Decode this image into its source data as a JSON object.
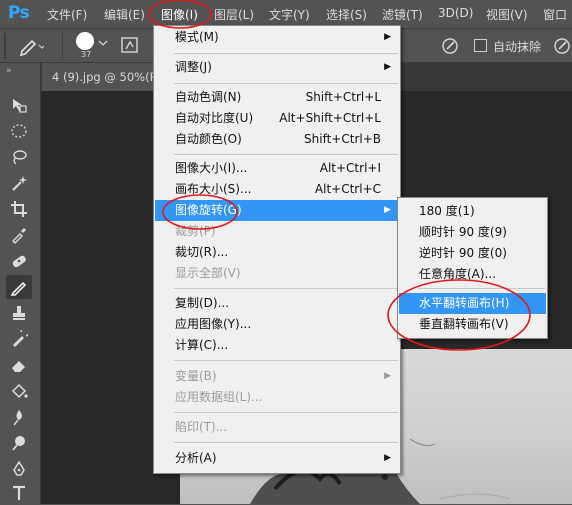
{
  "app": {
    "logo": "Ps"
  },
  "menubar": {
    "items": [
      {
        "label": "文件(F)"
      },
      {
        "label": "编辑(E)"
      },
      {
        "label": "图像(I)"
      },
      {
        "label": "图层(L)"
      },
      {
        "label": "文字(Y)"
      },
      {
        "label": "选择(S)"
      },
      {
        "label": "滤镜(T)"
      },
      {
        "label": "3D(D)"
      },
      {
        "label": "视图(V)"
      },
      {
        "label": "窗口"
      }
    ]
  },
  "options_bar": {
    "brush_size": "37",
    "auto_erase_label": "自动抹除"
  },
  "document_tab": {
    "title": "4 (9).jpg @ 50%(R"
  },
  "image_menu": {
    "items": [
      {
        "label": "模式(M)",
        "submenu": true
      },
      {
        "label": "调整(J)",
        "submenu": true
      },
      {
        "label": "自动色调(N)",
        "shortcut": "Shift+Ctrl+L"
      },
      {
        "label": "自动对比度(U)",
        "shortcut": "Alt+Shift+Ctrl+L"
      },
      {
        "label": "自动颜色(O)",
        "shortcut": "Shift+Ctrl+B"
      },
      {
        "label": "图像大小(I)...",
        "shortcut": "Alt+Ctrl+I"
      },
      {
        "label": "画布大小(S)...",
        "shortcut": "Alt+Ctrl+C"
      },
      {
        "label": "图像旋转(G)",
        "submenu": true,
        "highlighted": true
      },
      {
        "label": "裁剪(P)",
        "disabled": true
      },
      {
        "label": "裁切(R)..."
      },
      {
        "label": "显示全部(V)",
        "disabled": true
      },
      {
        "label": "复制(D)..."
      },
      {
        "label": "应用图像(Y)..."
      },
      {
        "label": "计算(C)..."
      },
      {
        "label": "变量(B)",
        "submenu": true,
        "disabled": true
      },
      {
        "label": "应用数据组(L)...",
        "disabled": true
      },
      {
        "label": "陷印(T)...",
        "disabled": true
      },
      {
        "label": "分析(A)",
        "submenu": true
      }
    ]
  },
  "rotate_menu": {
    "items": [
      {
        "label": "180 度(1)"
      },
      {
        "label": "顺时针 90 度(9)"
      },
      {
        "label": "逆时针 90 度(0)"
      },
      {
        "label": "任意角度(A)..."
      },
      {
        "label": "水平翻转画布(H)",
        "highlighted": true
      },
      {
        "label": "垂直翻转画布(V)"
      }
    ]
  },
  "colors": {
    "highlight": "#3296f7",
    "annotation": "#e0191b",
    "ps_blue": "#31a8ff"
  }
}
